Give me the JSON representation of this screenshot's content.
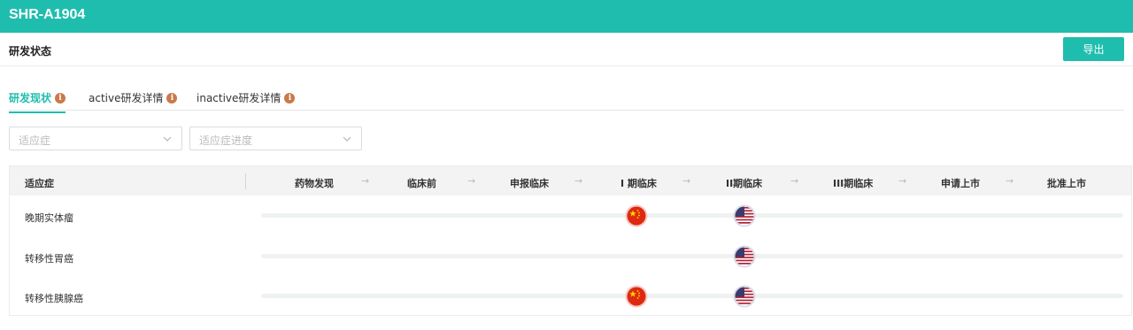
{
  "header": {
    "title": "SHR-A1904"
  },
  "section": {
    "title": "研发状态",
    "export_label": "导出"
  },
  "tabs": [
    {
      "label": "研发现状",
      "active": true,
      "icon": "info-icon"
    },
    {
      "label": "active研发详情",
      "active": false,
      "icon": "info-icon"
    },
    {
      "label": "inactive研发详情",
      "active": false,
      "icon": "info-icon"
    }
  ],
  "filters": {
    "indication": {
      "placeholder": "适应症",
      "icon": "chevron-down-icon"
    },
    "progress": {
      "placeholder": "适应症进度",
      "icon": "chevron-down-icon"
    }
  },
  "table": {
    "indication_header": "适应症",
    "stages": [
      "药物发现",
      "临床前",
      "申报临床",
      "I 期临床",
      "II期临床",
      "III期临床",
      "申请上市",
      "批准上市"
    ],
    "rows": [
      {
        "indication": "晚期实体瘤",
        "markers": [
          {
            "stage": "I 期临床",
            "flag": "china-flag-icon"
          },
          {
            "stage": "II期临床",
            "flag": "usa-flag-icon"
          }
        ]
      },
      {
        "indication": "转移性胃癌",
        "markers": [
          {
            "stage": "II期临床",
            "flag": "usa-flag-icon"
          }
        ]
      },
      {
        "indication": "转移性胰腺癌",
        "markers": [
          {
            "stage": "I 期临床",
            "flag": "china-flag-icon"
          },
          {
            "stage": "II期临床",
            "flag": "usa-flag-icon"
          }
        ]
      }
    ]
  },
  "colors": {
    "accent": "#1fbdad",
    "info_icon": "#c9794a",
    "china_red": "#de2910",
    "china_yellow": "#ffde00",
    "usa_blue": "#3c3b6e",
    "usa_red": "#b22234"
  }
}
